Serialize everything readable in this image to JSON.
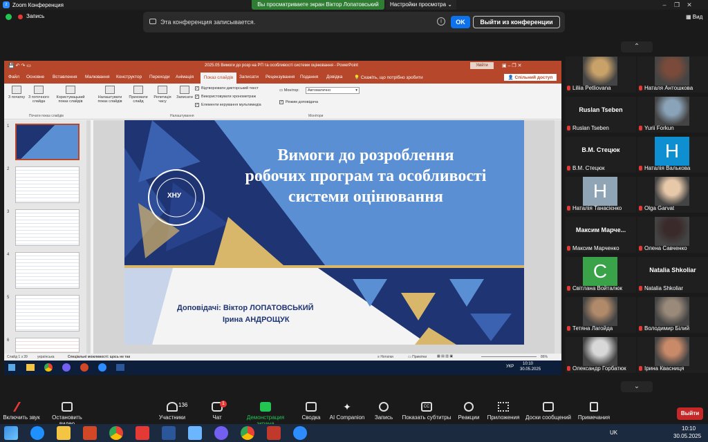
{
  "window": {
    "title": "Zoom Конференция",
    "share_banner": "Вы просматриваете экран Віктор Лопатовський",
    "view_settings": "Настройки просмотра",
    "view_label": "Вид"
  },
  "recording": {
    "indicator": "Запись",
    "message": "Эта конференция записывается.",
    "ok": "OK",
    "leave": "Выйти из конференции"
  },
  "ppt": {
    "title": "2025.05 Вимоги до розр на РП та особливості системи оцінювання - PowerPoint",
    "signin": "Увійти",
    "tabs": [
      "Файл",
      "Основне",
      "Вставлення",
      "Малювання",
      "Конструктор",
      "Переходи",
      "Анімація",
      "Показ слайдів",
      "Записати",
      "Рецензування",
      "Подання",
      "Довідка"
    ],
    "active_tab": "Показ слайдів",
    "tell_me": "Скажіть, що потрібно зробити",
    "share": "Спільний доступ",
    "ribbon": {
      "btn_from_start": "З початку",
      "btn_from_current": "З поточного слайда",
      "btn_custom": "Користувацький показ слайдів",
      "group_start": "Почати показ слайдів",
      "btn_setup": "Налаштувати показ слайдів",
      "btn_hide": "Приховати слайд",
      "btn_rehearse": "Репетиція часу",
      "btn_record": "Записати",
      "chk_narration": "Відтворювати дикторський текст",
      "chk_timings": "Використовувати хронометраж",
      "chk_media": "Елементи керування мультимедіа",
      "group_setup": "Налаштування",
      "monitor_label": "Монітор:",
      "monitor_value": "Автоматично",
      "presenter_view": "Режим доповідача",
      "group_monitors": "Монітори"
    },
    "thumb_numbers": [
      "1",
      "2",
      "3",
      "4",
      "5",
      "6"
    ],
    "slide": {
      "title_line1": "Вимоги до розроблення",
      "title_line2": "робочих програм та особливості",
      "title_line3": "системи оцінювання",
      "logo_text": "ХНУ",
      "presenters_label": "Доповідачі: Віктор ЛОПАТОВСЬКИЙ",
      "presenter2": "Ірина АНДРОЩУК"
    },
    "status": {
      "slide_count": "Слайд 1 з 39",
      "language": "українська",
      "accessibility": "Спеціальні можливості: щось не так",
      "notes": "Нотатки",
      "comments": "Примітки",
      "zoom": "86%"
    },
    "taskbar": {
      "lang": "УКР",
      "time": "10:10",
      "date": "30.05.2025"
    }
  },
  "participants": [
    {
      "name": "Liliia Petliovana",
      "kind": "photo",
      "color": "#c9a26a"
    },
    {
      "name": "Наталя Антошкова",
      "kind": "photo",
      "color": "#7a4b3a"
    },
    {
      "name": "Ruslan Tseben",
      "kind": "text",
      "display": "Ruslan Tseben"
    },
    {
      "name": "Yurii Forkun",
      "kind": "photo",
      "color": "#8aa3b8"
    },
    {
      "name": "В.М. Стецюк",
      "kind": "text",
      "display": "В.М. Стецюк"
    },
    {
      "name": "Наталія Валькова",
      "kind": "letter",
      "letter": "H",
      "color": "#0e8fd1"
    },
    {
      "name": "Наталія Танасієнко",
      "kind": "letter",
      "letter": "H",
      "color": "#8fa5b5"
    },
    {
      "name": "Olga Garvat",
      "kind": "photo",
      "color": "#e7c9a9"
    },
    {
      "name": "Максим Марченко",
      "kind": "text",
      "display": "Максим  Марче..."
    },
    {
      "name": "Олена Савченко",
      "kind": "photo",
      "color": "#3a2a2a"
    },
    {
      "name": "Світлана Войталюк",
      "kind": "letter",
      "letter": "C",
      "color": "#3aa34a"
    },
    {
      "name": "Natalia Shkoliar",
      "kind": "text",
      "display": "Natalia Shkoliar"
    },
    {
      "name": "Тетяна Лагойда",
      "kind": "photo",
      "color": "#b08a6a"
    },
    {
      "name": "Володимир Білий",
      "kind": "photo",
      "color": "#9a8a7a"
    },
    {
      "name": "Олександр Горбатюк",
      "kind": "photo",
      "color": "#d8d8d8"
    },
    {
      "name": "Ірина Квасниця",
      "kind": "photo",
      "color": "#c98a6a"
    }
  ],
  "toolbar": {
    "mute": "Включить звук",
    "video": "Остановить видео",
    "participants": "Участники",
    "participants_count": "136",
    "chat": "Чат",
    "chat_badge": "1",
    "share": "Демонстрация экрана",
    "whiteboard": "Сводка",
    "ai": "AI Companion",
    "record": "Запись",
    "captions": "Показать субтитры",
    "reactions": "Реакции",
    "apps": "Приложения",
    "boards": "Доски сообщений",
    "notes": "Примечания",
    "end": "Выйти"
  },
  "taskbar": {
    "lang": "UK",
    "time": "10:10",
    "date": "30.05.2025"
  },
  "colors": {
    "zoom_blue": "#0e72ed",
    "ppt_red": "#b7472a",
    "end_red": "#c62828",
    "share_green": "#2e7d32",
    "slide_blue": "#5b8fd3",
    "slide_navy": "#1e3473"
  }
}
